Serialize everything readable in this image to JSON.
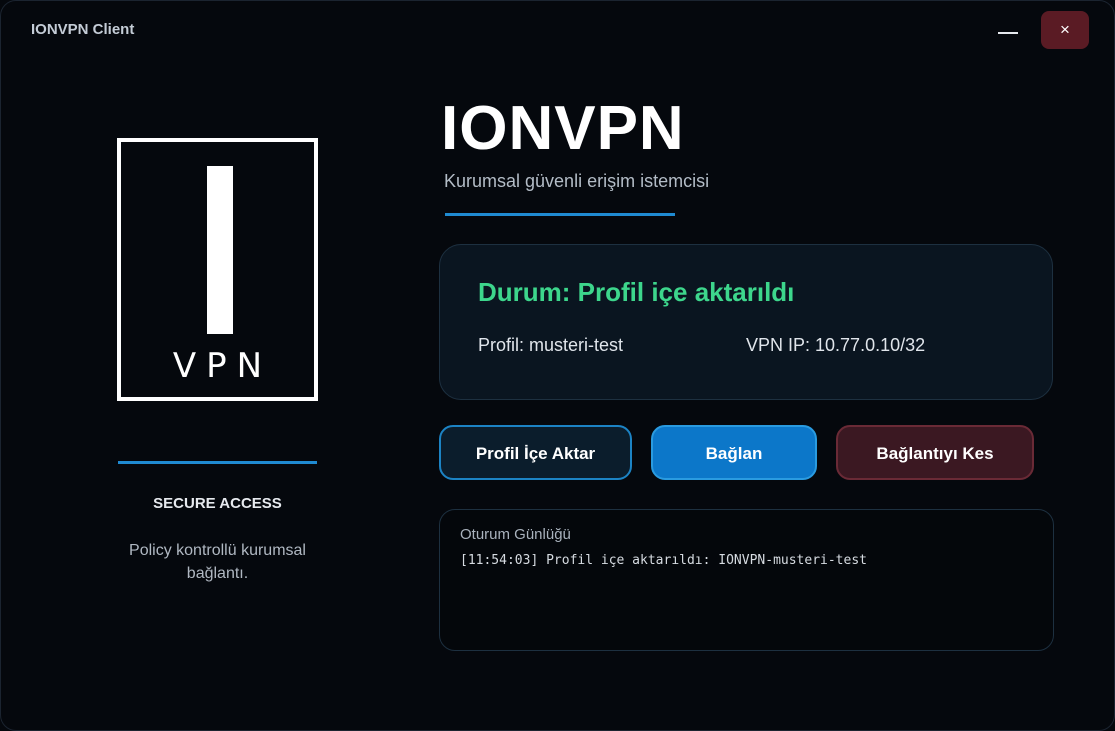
{
  "window": {
    "title": "IONVPN Client",
    "minimize_icon": "minimize-icon",
    "close_label": "×"
  },
  "logo": {
    "text": "VPN"
  },
  "sidebar": {
    "title": "SECURE ACCESS",
    "description": "Policy kontrollü kurumsal bağlantı."
  },
  "brand": {
    "title": "IONVPN",
    "subtitle": "Kurumsal güvenli erişim istemcisi"
  },
  "status": {
    "title": "Durum: Profil içe aktarıldı",
    "profile": "Profil: musteri-test",
    "vpn_ip": "VPN IP: 10.77.0.10/32",
    "color": "#3dd68c"
  },
  "actions": {
    "import_label": "Profil İçe Aktar",
    "connect_label": "Bağlan",
    "disconnect_label": "Bağlantıyı Kes"
  },
  "log": {
    "title": "Oturum Günlüğü",
    "entries": [
      "[11:54:03] Profil içe aktarıldı: IONVPN-musteri-test"
    ]
  },
  "colors": {
    "accent": "#1f8ad1",
    "close_bg": "#5a1b24",
    "connect_bg": "#0c77c9",
    "disconnect_bg": "#3b1822"
  }
}
